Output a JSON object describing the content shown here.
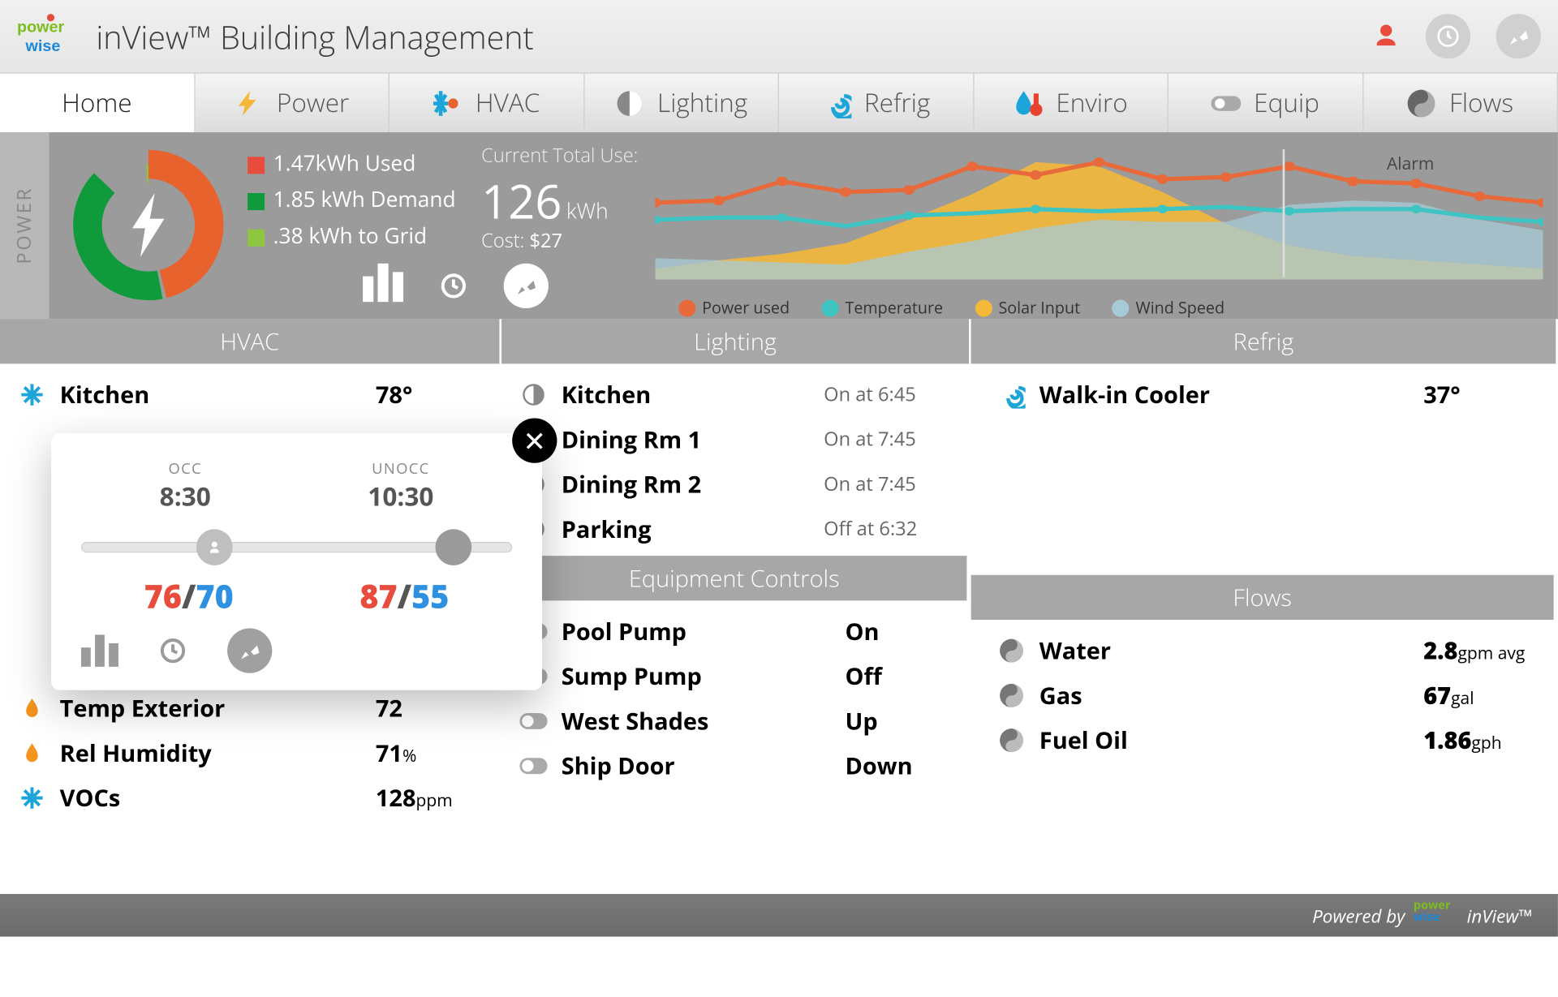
{
  "header": {
    "title": "inView™ Building Management"
  },
  "tabs": [
    "Home",
    "Power",
    "HVAC",
    "Lighting",
    "Refrig",
    "Enviro",
    "Equip",
    "Flows"
  ],
  "power": {
    "side": "POWER",
    "legend": {
      "used": "1.47kWh Used",
      "demand": "1.85 kWh Demand",
      "grid": ".38 kWh to Grid"
    },
    "total_label": "Current Total Use:",
    "total_value": "126",
    "total_unit": "kWh",
    "cost_label": "Cost:",
    "cost_value": "$27",
    "chart_legend": [
      "Power used",
      "Temperature",
      "Solar Input",
      "Wind Speed"
    ],
    "alarm": "Alarm",
    "chart_data": {
      "type": "line",
      "x": [
        0,
        1,
        2,
        3,
        4,
        5,
        6,
        7,
        8,
        9,
        10,
        11,
        12,
        13
      ],
      "series": [
        {
          "name": "Power used",
          "values": [
            64,
            66,
            80,
            72,
            74,
            90,
            85,
            94,
            82,
            84,
            92,
            80,
            70,
            66
          ],
          "color": "#e86a3a"
        },
        {
          "name": "Temperature",
          "values": [
            48,
            50,
            50,
            44,
            52,
            54,
            56,
            55,
            56,
            57,
            55,
            56,
            50,
            48
          ],
          "color": "#3fc4c4"
        },
        {
          "name": "Solar Input",
          "values": [
            20,
            28,
            32,
            40,
            60,
            80,
            100,
            96,
            78,
            54,
            36,
            28,
            24,
            20
          ],
          "color": "#f4b83a",
          "area": true
        },
        {
          "name": "Wind Speed",
          "values": [
            26,
            24,
            22,
            20,
            30,
            36,
            44,
            50,
            48,
            48,
            60,
            62,
            48,
            40
          ],
          "color": "#a7cbd6",
          "area": true
        }
      ],
      "ylim": [
        0,
        110
      ],
      "alarm_x": 10
    }
  },
  "sections": {
    "hvac": {
      "title": "HVAC",
      "rows": [
        {
          "icon": "snow",
          "label": "Kitchen",
          "value": "78°"
        },
        {
          "icon": "flame",
          "label": "Temp Exterior",
          "value": "72"
        },
        {
          "icon": "flame",
          "label": "Rel Humidity",
          "value": "71",
          "unit": "%"
        },
        {
          "icon": "snow",
          "label": "VOCs",
          "value": "128",
          "unit": "ppm"
        }
      ]
    },
    "lighting": {
      "title": "Lighting",
      "rows": [
        {
          "label": "Kitchen",
          "status": "On at 6:45"
        },
        {
          "label": "Dining Rm 1",
          "status": "On at 7:45"
        },
        {
          "label": "Dining Rm 2",
          "status": "On at 7:45"
        },
        {
          "label": "Parking",
          "status": "Off at 6:32"
        }
      ]
    },
    "refrig": {
      "title": "Refrig",
      "rows": [
        {
          "icon": "spiral",
          "label": "Walk-in Cooler",
          "value": "37°"
        }
      ]
    },
    "equip": {
      "title": "Equipment Controls",
      "rows": [
        {
          "label": "Pool Pump",
          "status": "On"
        },
        {
          "label": "Sump Pump",
          "status": "Off"
        },
        {
          "label": "West Shades",
          "status": "Up"
        },
        {
          "label": "Ship Door",
          "status": "Down"
        }
      ]
    },
    "flows": {
      "title": "Flows",
      "rows": [
        {
          "label": "Water",
          "value": "2.8",
          "unit": "gpm avg"
        },
        {
          "label": "Gas",
          "value": "67",
          "unit": "gal"
        },
        {
          "label": "Fuel Oil",
          "value": "1.86",
          "unit": "gph"
        }
      ]
    }
  },
  "popup": {
    "occ_label": "OCC",
    "occ_time": "8:30",
    "unocc_label": "UNOCC",
    "unocc_time": "10:30",
    "occ_heat": "76",
    "occ_cool": "70",
    "unocc_heat": "87",
    "unocc_cool": "55"
  },
  "footer": {
    "prefix": "Powered by",
    "suffix": "inView™"
  }
}
